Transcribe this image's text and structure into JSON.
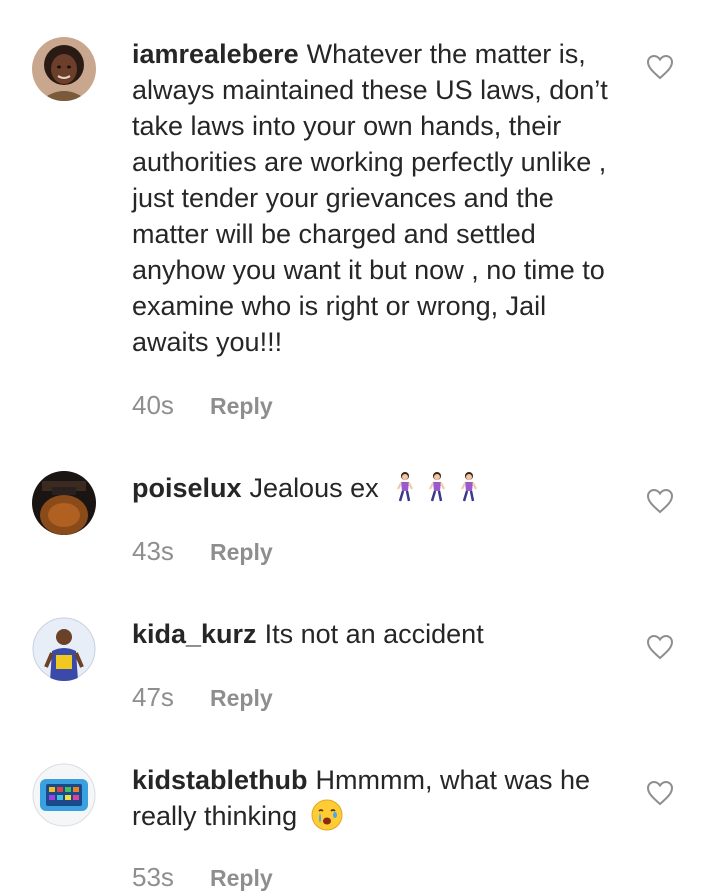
{
  "comments": [
    {
      "username": "iamrealebere",
      "text": "Whatever the matter is, always maintained these US laws, don’t take laws into your own hands, their authorities are working perfectly unlike , just tender your grievances and the matter will be charged and settled anyhow you want it but now , no time to examine who is right or wrong, Jail awaits you!!!",
      "time": "40s",
      "reply_label": "Reply"
    },
    {
      "username": "poiselux",
      "text": "Jealous ex",
      "emoji": "woman-walking-emoji x3",
      "time": "43s",
      "reply_label": "Reply"
    },
    {
      "username": "kida_kurz",
      "text": "Its not an accident",
      "time": "47s",
      "reply_label": "Reply"
    },
    {
      "username": "kidstablethub",
      "text": "Hmmmm, what was he really thinking",
      "emoji": "crying-face-emoji",
      "time": "53s",
      "reply_label": "Reply"
    }
  ],
  "colors": {
    "text": "#262626",
    "secondary": "#8e8e8e"
  },
  "icons": {
    "like": "heart-outline-icon"
  }
}
